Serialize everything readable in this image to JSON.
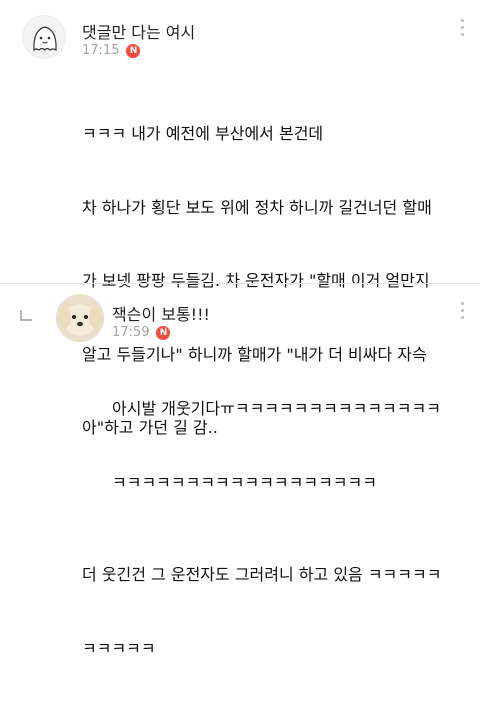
{
  "comments": [
    {
      "author": "댓글만 다는 여시",
      "time": "17:15",
      "badge": "N",
      "lines": [
        "ㅋㅋㅋ 내가 예전에 부산에서 본건데",
        "차 하나가 횡단 보도 위에 정차 하니까 길건너던 할매",
        "가 보넷 팡팡 두들김. 차 운전자가 \"할매 이거 얼만지",
        "알고 두들기나\" 하니까 할매가 \"내가 더 비싸다 자슥",
        "아\"하고 가던 길 감..",
        "",
        "더 웃긴건 그 운전자도 그러려니 하고 있음 ㅋㅋㅋㅋㅋ",
        "ㅋㅋㅋㅋㅋ"
      ]
    },
    {
      "author": "잭슨이 보통!!!",
      "time": "17:59",
      "badge": "N",
      "lines": [
        "아시발 개웃기다ㅠㅋㅋㅋㅋㅋㅋㅋㅋㅋㅋㅋㅋㅋㅋ",
        "ㅋㅋㅋㅋㅋㅋㅋㅋㅋㅋㅋㅋㅋㅋㅋㅋㅋㅋ"
      ]
    }
  ]
}
